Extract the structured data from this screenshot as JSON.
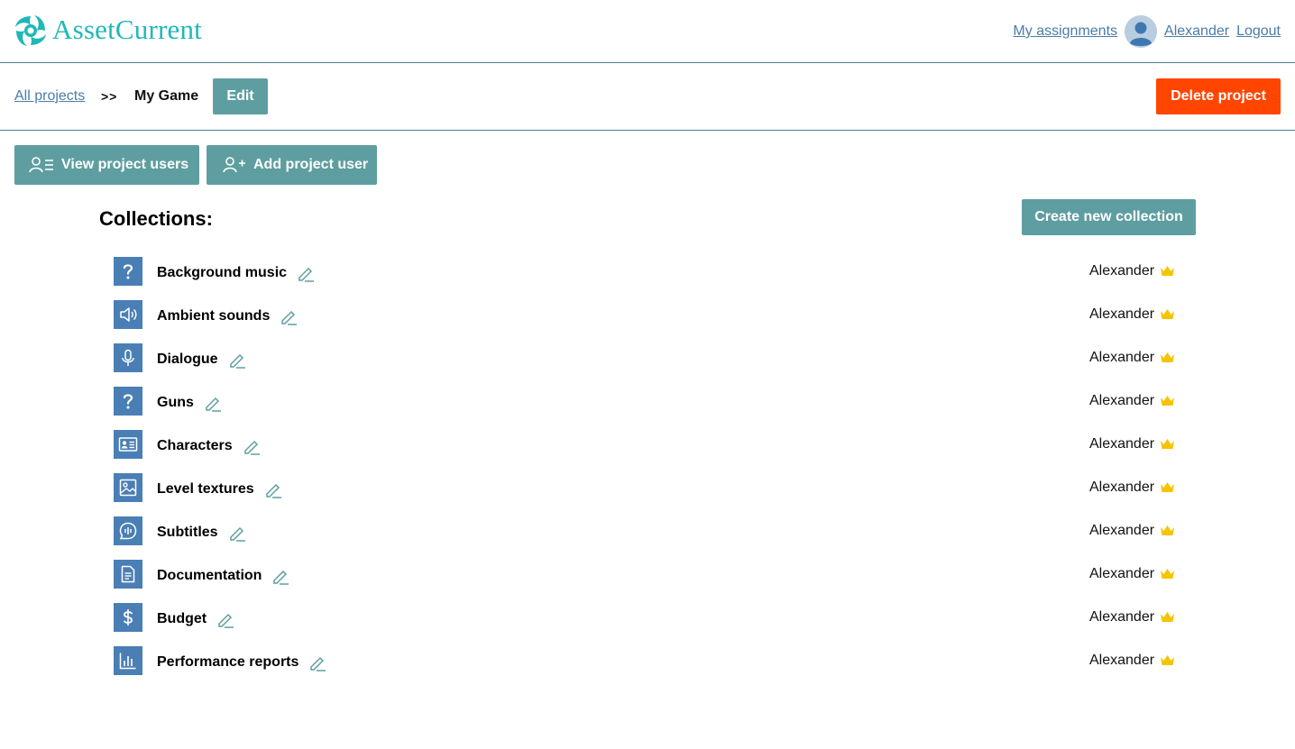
{
  "header": {
    "brand": "AssetCurrent",
    "my_assignments": "My assignments",
    "username": "Alexander",
    "logout": "Logout",
    "brand_color": "#1fb8b8"
  },
  "breadcrumb": {
    "all_projects": "All projects",
    "separator": ">>",
    "current": "My Game",
    "edit_label": "Edit"
  },
  "actions": {
    "delete_project": "Delete project",
    "view_project_users": "View project users",
    "add_project_user": "Add project user",
    "create_new_collection": "Create new collection"
  },
  "collections": {
    "title": "Collections:",
    "items": [
      {
        "name": "Background music",
        "icon": "question-icon",
        "owner": "Alexander"
      },
      {
        "name": "Ambient sounds",
        "icon": "speaker-icon",
        "owner": "Alexander"
      },
      {
        "name": "Dialogue",
        "icon": "microphone-icon",
        "owner": "Alexander"
      },
      {
        "name": "Guns",
        "icon": "question-icon",
        "owner": "Alexander"
      },
      {
        "name": "Characters",
        "icon": "id-card-icon",
        "owner": "Alexander"
      },
      {
        "name": "Level textures",
        "icon": "image-icon",
        "owner": "Alexander"
      },
      {
        "name": "Subtitles",
        "icon": "speech-bubble-icon",
        "owner": "Alexander"
      },
      {
        "name": "Documentation",
        "icon": "document-icon",
        "owner": "Alexander"
      },
      {
        "name": "Budget",
        "icon": "dollar-icon",
        "owner": "Alexander"
      },
      {
        "name": "Performance reports",
        "icon": "bar-chart-icon",
        "owner": "Alexander"
      }
    ]
  },
  "colors": {
    "teal_button": "#5f9ea0",
    "danger_button": "#ff4500",
    "icon_tile": "#4a7fb5",
    "link": "#4a7ca8",
    "crown": "#f5c400"
  }
}
